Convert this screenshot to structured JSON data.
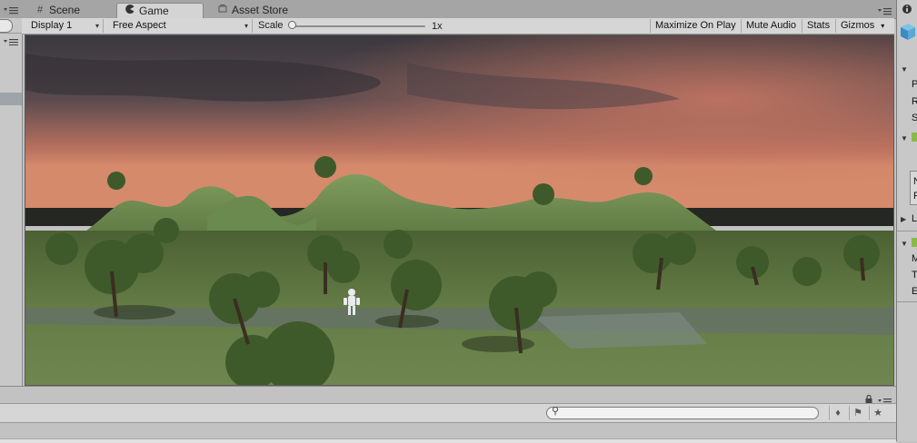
{
  "tabs": [
    {
      "label": "Scene",
      "icon": "grid-icon"
    },
    {
      "label": "Game",
      "icon": "pacman-icon"
    },
    {
      "label": "Asset Store",
      "icon": "bag-icon"
    }
  ],
  "toolbar": {
    "display": "Display 1",
    "aspect": "Free Aspect",
    "scale_label": "Scale",
    "scale_value": "1x",
    "maximize_on_play": "Maximize On Play",
    "mute_audio": "Mute Audio",
    "stats": "Stats",
    "gizmos": "Gizmos"
  },
  "inspector": {
    "rows": [
      "P",
      "R",
      "S",
      "N",
      "R",
      "L",
      "M",
      "T",
      "E"
    ]
  },
  "colors": {
    "sky_top": "#3f3b3f",
    "sky_glow": "#c0705a",
    "grass": "#5f7642",
    "hill": "#6f8d52"
  }
}
